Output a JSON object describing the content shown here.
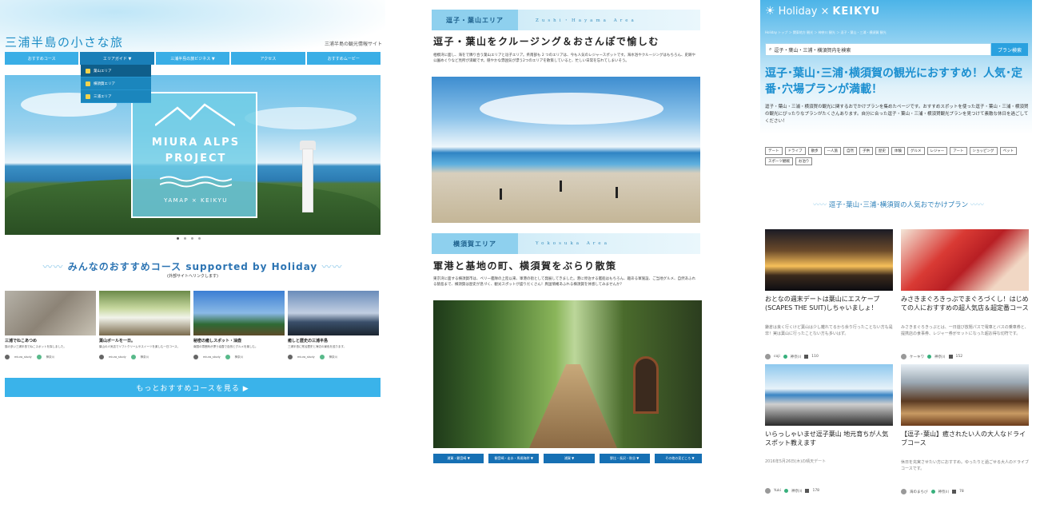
{
  "panel1": {
    "site_title": "三浦半島の小さな旅",
    "site_subtitle": "三浦半島の観光情報サイト",
    "nav": [
      "おすすめコース",
      "エリアガイド ▼",
      "三浦半島の旅ビジネス ▼",
      "アクセス",
      "おすすめムービー"
    ],
    "dropdown": [
      "葉山エリア",
      "横須賀エリア",
      "三浦エリア"
    ],
    "hero": {
      "line1": "MIURA ALPS",
      "line2": "PROJECT",
      "line3": "YAMAP × KEIKYU"
    },
    "section_title": "みんなのおすすめコース supported by Holiday",
    "section_subtitle": "(外部サイトへリンクします)",
    "cards": [
      {
        "title": "三浦でねこあつめ",
        "text": "猫の多い三浦半島でねこスポットを探しました。",
        "user": "miura_study",
        "pref": "神奈川"
      },
      {
        "title": "葉山ボールを一日。",
        "text": "葉山の人気店でソフトクリームやスイーツを楽しむ一日コース。",
        "user": "miura_study",
        "pref": "神奈川"
      },
      {
        "title": "秘密の癒しスポット・油壺",
        "text": "南国の雰囲気が漂う油壺で自然とグルメを楽しむ。",
        "user": "miura_study",
        "pref": "神奈川"
      },
      {
        "title": "癒しと歴史の三浦半島",
        "text": "三浦半島に残る歴史と海辺の景色を巡ります。",
        "user": "miura_study",
        "pref": "神奈川"
      }
    ],
    "more_button": "もっとおすすめコースを見る ▶"
  },
  "panel2": {
    "area1_jp": "逗子・葉山エリア",
    "area1_en": "Zushi・Hayama Area",
    "heading1": "逗子・葉山をクルージング＆おさんぽで愉しむ",
    "body1": "相模湾に面し、海をで隣り合う葉山エリアと逗子エリア。県南部も 2 つのエリアは、今も人気のレジャースポットです。海水浴やクルージングはもちろん、史跡や公園めぐりなど見所が満載です。穏やかな雰囲気が漂う2つのエリアを散策していると、忙しい日常を忘れてしまいそう。",
    "area2_jp": "横須賀エリア",
    "area2_en": "Yokosuka Area",
    "heading2": "軍港と基地の町、横須賀をぶらり散策",
    "body2": "東京湾に面する横須賀市は、ペリー艦隊の上陸以来、軍港の街として発展してきました。港に停泊する艦船はもちろん、趣ある軍施設、ご当地グルメ、自然あふれる猿島まで、横須賀は歴史が息づく、観光スポットが盛りだくさん！異国情緒あふれる横須賀を体感してみませんか？",
    "buttons": [
      "浦賀・観音崎 ▼",
      "観音崎・走水・馬堀海岸 ▼",
      "浦賀 ▼",
      "野比・長沢・秋谷 ▼",
      "その他の見どころ ▼"
    ]
  },
  "panel3": {
    "brand_holiday": "Holiday",
    "brand_x": "×",
    "brand_keikyu": "KEIKYU",
    "breadcrumb": "Holiday トップ ＞ 関東地方 観光 ＞ 神奈川 観光 ＞ 逗子・葉山・三浦・横須賀 観光",
    "search_value": "逗子・葉山・三浦・横須賀内を検索",
    "search_button": "プラン検索",
    "headline": "逗子･葉山･三浦･横須賀の観光におすすめ！人気･定番･穴場プランが満載！",
    "intro": "逗子・葉山・三浦・横須賀の観光に関するおでかけプランを集めたページです。おすすめスポットを使った逗子・葉山・三浦・横須賀の観光にぴったりなプランがたくさんあります。自分に合った逗子・葉山・三浦・横須賀観光プランを見つけて素敵な休日を過ごしてください！",
    "tags": [
      "デート",
      "ドライブ",
      "散歩",
      "一人旅",
      "自然",
      "子供",
      "歴史",
      "体験",
      "グルメ",
      "レジャー",
      "アート",
      "ショッピング",
      "ペット",
      "スポーツ観戦",
      "お泊り"
    ],
    "popular_title": "逗子･葉山･三浦･横須賀の人気おでかけプラン",
    "plans": [
      {
        "title": "おとなの週末デートは葉山にエスケープ(SCAPES THE SUIT)しちゃいましょ！",
        "text": "鎌倉は良く行くけど葉山は少し離れてるから余り行ったことない方も是非！実は葉山に行ったことない方も多いはず。",
        "user": "coji",
        "pref": "神奈川",
        "count": "110"
      },
      {
        "title": "みさきまぐろきっぷでまぐろづくし！はじめての人におすすめの超人気店＆超定番コース",
        "text": "みさきまぐろきっぷとは、一日遊び放題パスで電車とバスの乗車券と、提携店の食事券、レジャー券がセットになった超お得な切符です。",
        "user": "ケーキワ",
        "pref": "神奈川",
        "count": "152"
      },
      {
        "title": "いらっしゃいませ逗子葉山 地元育ちが人気スポット教えます",
        "date": "2016年5月26日(木)の晴天デート",
        "user": "Yuki",
        "pref": "神奈川",
        "count": "178"
      },
      {
        "title": "【逗子･葉山】癒されたい人の大人なドライブコース",
        "text": "休日を充実させたい方におすすめ。ゆったりと過ごせる大人のドライブコースです。",
        "user": "海のまちび",
        "pref": "神奈川",
        "count": "78"
      }
    ]
  }
}
